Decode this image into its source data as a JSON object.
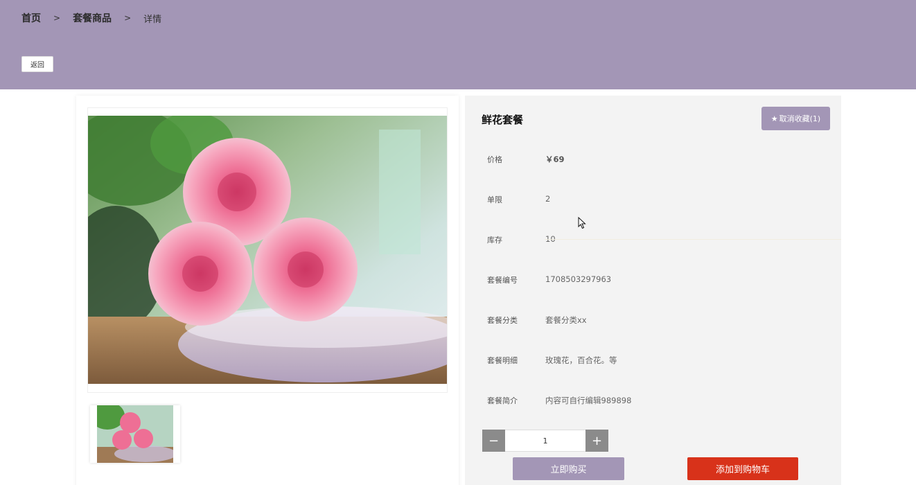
{
  "breadcrumb": {
    "home": "首页",
    "separator": ">",
    "category": "套餐商品",
    "current": "详情"
  },
  "back_label": "返回",
  "product": {
    "title": "鲜花套餐",
    "favorite_label": "取消收藏(1)",
    "fields": [
      {
        "label": "价格",
        "value": "￥69"
      },
      {
        "label": "单限",
        "value": "2"
      },
      {
        "label": "库存",
        "value": "10"
      },
      {
        "label": "套餐编号",
        "value": "1708503297963"
      },
      {
        "label": "套餐分类",
        "value": "套餐分类xx"
      },
      {
        "label": "套餐明细",
        "value": "玫瑰花，百合花。等"
      },
      {
        "label": "套餐简介",
        "value": "内容可自行编辑989898"
      }
    ]
  },
  "quantity": {
    "minus": "−",
    "value": "1",
    "plus": "+"
  },
  "actions": {
    "buy_now": "立即购买",
    "add_to_cart": "添加到购物车"
  },
  "colors": {
    "brand": "#a396b6",
    "cart": "#d8321a"
  }
}
